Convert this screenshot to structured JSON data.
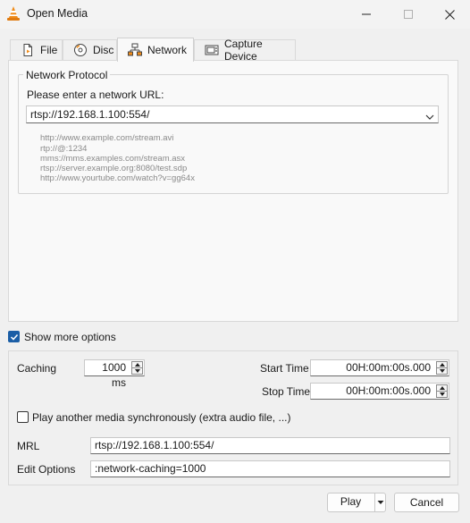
{
  "window": {
    "title": "Open Media"
  },
  "tabs": [
    {
      "label": "File",
      "icon": "file-icon"
    },
    {
      "label": "Disc",
      "icon": "disc-icon"
    },
    {
      "label": "Network",
      "icon": "network-icon",
      "active": true
    },
    {
      "label": "Capture Device",
      "icon": "capture-device-icon"
    }
  ],
  "network": {
    "group_title": "Network Protocol",
    "prompt": "Please enter a network URL:",
    "url_value": "rtsp://192.168.1.100:554/",
    "examples": [
      "http://www.example.com/stream.avi",
      "rtp://@:1234",
      "mms://mms.examples.com/stream.asx",
      "rtsp://server.example.org:8080/test.sdp",
      "http://www.yourtube.com/watch?v=gg64x"
    ]
  },
  "more_options": {
    "label": "Show more options",
    "checked": true
  },
  "options": {
    "caching_label": "Caching",
    "caching_value": "1000 ms",
    "start_time_label": "Start Time",
    "start_time_value": "00H:00m:00s.000",
    "stop_time_label": "Stop Time",
    "stop_time_value": "00H:00m:00s.000",
    "sync_label": "Play another media synchronously (extra audio file, ...)",
    "sync_checked": false,
    "mrl_label": "MRL",
    "mrl_value": "rtsp://192.168.1.100:554/",
    "edit_options_label": "Edit Options",
    "edit_options_value": ":network-caching=1000"
  },
  "buttons": {
    "play": "Play",
    "cancel": "Cancel"
  },
  "colors": {
    "accent": "#1b5ea6",
    "vlc_orange": "#f08c1a"
  }
}
